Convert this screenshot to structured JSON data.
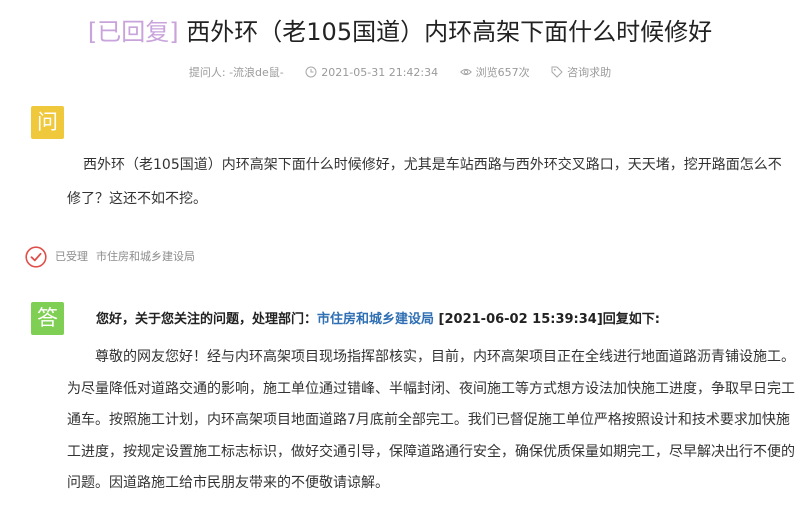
{
  "post": {
    "status_tag": "[已回复]",
    "title": "西外环（老105国道）内环高架下面什么时候修好",
    "meta": {
      "asker": "提问人: -流浪de鼠-",
      "datetime": "2021-05-31 21:42:34",
      "views": "浏览657次",
      "category": "咨询求助"
    }
  },
  "question": {
    "badge": "问",
    "text": "西外环（老105国道）内环高架下面什么时候修好，尤其是车站西路与西外环交叉路口，天天堵，挖开路面怎么不修了？这还不如不挖。"
  },
  "acceptance": {
    "status": "已受理",
    "department": "市住房和城乡建设局"
  },
  "answer": {
    "badge": "答",
    "head_prefix": "您好，关于您关注的问题，处理部门：",
    "department": "市住房和城乡建设局",
    "head_suffix": " [2021-06-02 15:39:34]回复如下:",
    "text": "尊敬的网友您好！经与内环高架项目现场指挥部核实，目前，内环高架项目正在全线进行地面道路沥青铺设施工。为尽量降低对道路交通的影响，施工单位通过错峰、半幅封闭、夜间施工等方式想方设法加快施工进度，争取早日完工通车。按照施工计划，内环高架项目地面道路7月底前全部完工。我们已督促施工单位严格按照设计和技术要求加快施工进度，按规定设置施工标志标识，做好交通引导，保障道路通行安全，确保优质保量如期完工，尽早解决出行不便的问题。因道路施工给市民朋友带来的不便敬请谅解。"
  },
  "colors": {
    "status_tag": "#c9a3dc",
    "question_badge": "#f0c83c",
    "answer_badge": "#7ecf53",
    "accepted_icon": "#e0504a",
    "department_link": "#2f6fb3"
  }
}
